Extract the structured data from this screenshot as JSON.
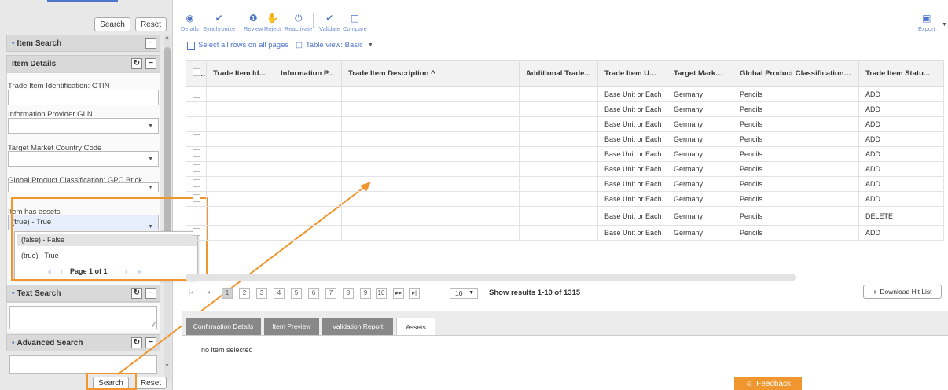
{
  "left": {
    "search_label": "Search",
    "reset_label": "Reset",
    "item_search": "Item Search",
    "item_details": "Item Details",
    "fields": [
      {
        "label": "Trade Item Identification: GTIN",
        "value": ""
      },
      {
        "label": "Information Provider GLN",
        "value": ""
      },
      {
        "label": "Target Market Country Code",
        "value": ""
      },
      {
        "label": "Global Product Classification: GPC Brick",
        "value": ""
      }
    ],
    "assets_label": "Item has assets",
    "assets_value": "(true) - True",
    "dropdown": {
      "options": [
        "(false) - False",
        "(true) - True"
      ],
      "page_label": "Page 1 of 1"
    },
    "text_search": "Text Search",
    "advanced_search": "Advanced Search",
    "bottom_search": "Search",
    "bottom_reset": "Reset"
  },
  "toolbar": {
    "tools": [
      {
        "label": "Details",
        "icon": "eye-icon",
        "glyph": "◉"
      },
      {
        "label": "Synchronize",
        "icon": "check-icon",
        "glyph": "✔"
      },
      {
        "label": "Review",
        "icon": "alert-icon",
        "glyph": "❶"
      },
      {
        "label": "Reject",
        "icon": "thumbs-down-icon",
        "glyph": "✋"
      },
      {
        "label": "Reactivate",
        "icon": "power-icon",
        "glyph": "⏻"
      },
      {
        "label": "Validate",
        "icon": "check-icon",
        "glyph": "✔"
      },
      {
        "label": "Compare",
        "icon": "columns-icon",
        "glyph": "◫"
      }
    ],
    "export_label": "Export",
    "select_all": "Select all rows on all pages",
    "table_view": "Table view: Basic"
  },
  "table": {
    "headers": [
      "Trade Item Id...",
      "Information P...",
      "Trade Item Description ^",
      "Additional Trade...",
      "Trade Item Uni...",
      "Target Market ...",
      "Global Product Classification: ...",
      "Trade Item Statu..."
    ],
    "rows": [
      [
        "",
        "",
        "",
        "",
        "Base Unit or Each",
        "Germany",
        "Pencils",
        "ADD"
      ],
      [
        "",
        "",
        "",
        "",
        "Base Unit or Each",
        "Germany",
        "Pencils",
        "ADD"
      ],
      [
        "",
        "",
        "",
        "",
        "Base Unit or Each",
        "Germany",
        "Pencils",
        "ADD"
      ],
      [
        "",
        "",
        "",
        "",
        "Base Unit or Each",
        "Germany",
        "Pencils",
        "ADD"
      ],
      [
        "",
        "",
        "",
        "",
        "Base Unit or Each",
        "Germany",
        "Pencils",
        "ADD"
      ],
      [
        "",
        "",
        "",
        "",
        "Base Unit or Each",
        "Germany",
        "Pencils",
        "ADD"
      ],
      [
        "",
        "",
        "",
        "",
        "Base Unit or Each",
        "Germany",
        "Pencils",
        "ADD"
      ],
      [
        "",
        "",
        "",
        "",
        "Base Unit or Each",
        "Germany",
        "Pencils",
        "ADD"
      ],
      [
        "",
        "",
        "",
        "",
        "Base Unit or Each",
        "Germany",
        "Pencils",
        "DELETE"
      ],
      [
        "",
        "",
        "",
        "",
        "Base Unit or Each",
        "Germany",
        "Pencils",
        "ADD"
      ]
    ]
  },
  "pagination": {
    "pages": [
      "1",
      "2",
      "3",
      "4",
      "5",
      "6",
      "7",
      "8",
      "9",
      "10"
    ],
    "per_page": "10",
    "results": "Show results 1-10 of 1315",
    "download": "Download Hit List"
  },
  "tabs": [
    "Confirmation Details",
    "Item Preview",
    "Validation Report",
    "Assets"
  ],
  "status": "no item selected",
  "feedback": "Feedback",
  "colors": {
    "accent": "#f0962e",
    "link": "#4f76c8"
  }
}
